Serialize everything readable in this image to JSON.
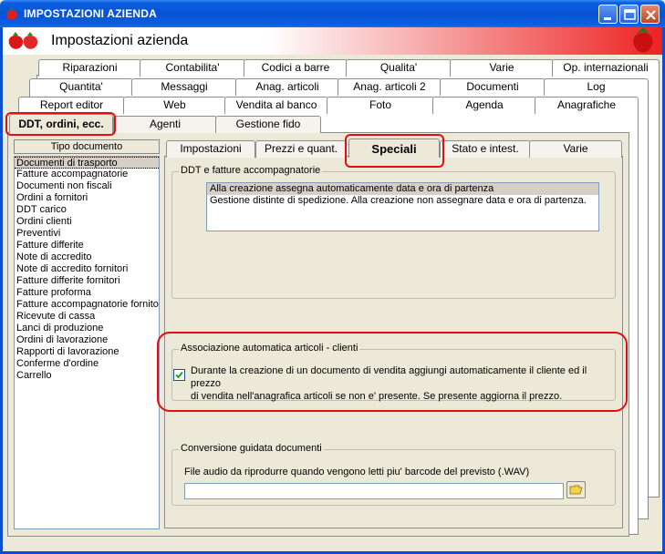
{
  "window": {
    "title": "IMPOSTAZIONI AZIENDA",
    "header_title": "Impostazioni azienda"
  },
  "tabs_row1": [
    "Riparazioni",
    "Contabilita'",
    "Codici a barre",
    "Qualita'",
    "Varie",
    "Op. internazionali"
  ],
  "tabs_row2": [
    "Quantita'",
    "Messaggi",
    "Anag. articoli",
    "Anag. articoli 2",
    "Documenti",
    "Log"
  ],
  "tabs_row3": [
    "Report editor",
    "Web",
    "Vendita al banco",
    "Foto",
    "Agenda",
    "Anagrafiche"
  ],
  "tabs_row4": [
    "DDT, ordini, ecc.",
    "Agenti",
    "Gestione fido"
  ],
  "doc_list": {
    "header": "Tipo documento",
    "items": [
      "Documenti di trasporto",
      "Fatture accompagnatorie",
      "Documenti non fiscali",
      "Ordini a fornitori",
      "DDT carico",
      "Ordini clienti",
      "Preventivi",
      "Fatture differite",
      "Note di accredito",
      "Note di accredito fornitori",
      "Fatture differite fornitori",
      "Fatture proforma",
      "Fatture accompagnatorie fornitori",
      "Ricevute di cassa",
      "Lanci di produzione",
      "Ordini di lavorazione",
      "Rapporti di lavorazione",
      "Conferme d'ordine",
      "Carrello"
    ]
  },
  "inner_tabs": [
    "Impostazioni",
    "Prezzi e quant.",
    "Speciali",
    "Stato e intest.",
    "Varie"
  ],
  "ddt_group": {
    "title": "DDT e fatture accompagnatorie",
    "options": [
      "Alla creazione assegna automaticamente data e ora di partenza",
      "Gestione distinte di spedizione. Alla creazione non assegnare data e ora di partenza."
    ]
  },
  "assoc_group": {
    "title": "Associazione automatica articoli - clienti",
    "checkbox_line1": "Durante la creazione di un documento di vendita aggiungi automaticamente il cliente ed il prezzo",
    "checkbox_line2": "di vendita nell'anagrafica articoli se non e' presente. Se presente aggiorna il prezzo.",
    "checked": true
  },
  "conv_group": {
    "title": "Conversione guidata documenti",
    "label": "File audio da riprodurre quando vengono letti piu' barcode del previsto  (.WAV)",
    "value": ""
  },
  "colors": {
    "titlebar": "#0a5fe0",
    "highlight": "#e01010",
    "face": "#ece9d8"
  }
}
